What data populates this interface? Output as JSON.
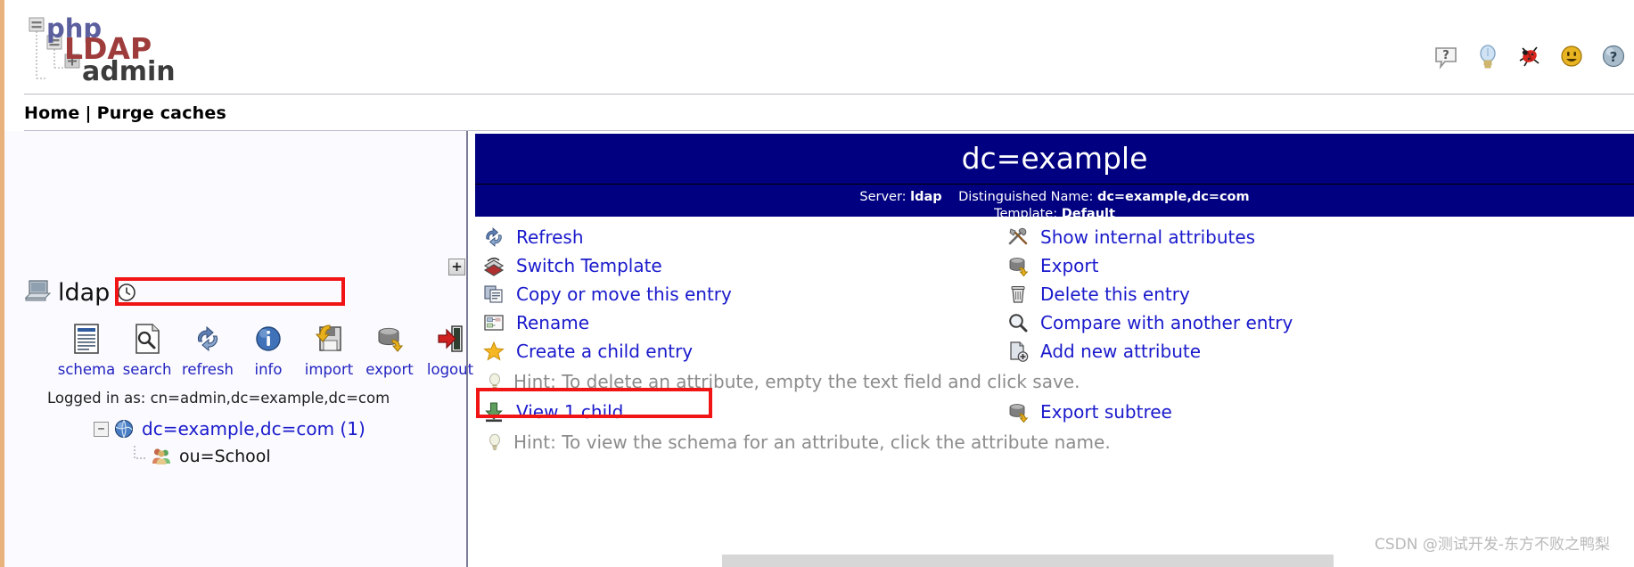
{
  "app": {
    "logo_parts": [
      "php",
      "LDAP",
      "admin"
    ],
    "title": "phpLDAPadmin"
  },
  "header": {
    "icons": [
      {
        "name": "help-tooltip-icon",
        "glyph": "?"
      },
      {
        "name": "lightbulb-icon",
        "glyph": "lightbulb"
      },
      {
        "name": "bug-icon",
        "glyph": "bug"
      },
      {
        "name": "smiley-icon",
        "glyph": "smiley"
      },
      {
        "name": "help-sphere-icon",
        "glyph": "?"
      }
    ]
  },
  "breadcrumb": {
    "home": "Home",
    "separator": "|",
    "purge": "Purge caches"
  },
  "sidebar": {
    "expand_label": "+",
    "server_name": "ldap",
    "tools": [
      {
        "label": "schema",
        "icon": "schema-icon"
      },
      {
        "label": "search",
        "icon": "search-icon"
      },
      {
        "label": "refresh",
        "icon": "refresh-icon"
      },
      {
        "label": "info",
        "icon": "info-icon"
      },
      {
        "label": "import",
        "icon": "import-icon"
      },
      {
        "label": "export",
        "icon": "export-icon"
      },
      {
        "label": "logout",
        "icon": "logout-icon"
      }
    ],
    "logged_in_as": "Logged in as: cn=admin,dc=example,dc=com",
    "tree": {
      "root": {
        "toggle": "−",
        "label": "dc=example,dc=com (1)",
        "icon": "globe-icon",
        "highlighted": true
      },
      "children": [
        {
          "label": "ou=School",
          "icon": "users-icon"
        }
      ]
    }
  },
  "main": {
    "entry_title": "dc=example",
    "meta": {
      "server_label": "Server:",
      "server_value": "ldap",
      "dn_label": "Distinguished Name:",
      "dn_value": "dc=example,dc=com",
      "template_label": "Template:",
      "template_value": "Default"
    },
    "rows": [
      {
        "left": {
          "label": "Refresh",
          "icon": "refresh-icon",
          "kind": "link"
        },
        "right": {
          "label": "Show internal attributes",
          "icon": "tools-icon",
          "kind": "link"
        }
      },
      {
        "left": {
          "label": "Switch Template",
          "icon": "switch-template-icon",
          "kind": "link"
        },
        "right": {
          "label": "Export",
          "icon": "export-icon",
          "kind": "link"
        }
      },
      {
        "left": {
          "label": "Copy or move this entry",
          "icon": "copy-icon",
          "kind": "link"
        },
        "right": {
          "label": "Delete this entry",
          "icon": "trash-icon",
          "kind": "link"
        }
      },
      {
        "left": {
          "label": "Rename",
          "icon": "rename-icon",
          "kind": "link"
        },
        "right": {
          "label": "Compare with another entry",
          "icon": "compare-icon",
          "kind": "link"
        }
      },
      {
        "left": {
          "label": "Create a child entry",
          "icon": "star-icon",
          "kind": "link",
          "highlighted": true
        },
        "right": {
          "label": "Add new attribute",
          "icon": "add-attribute-icon",
          "kind": "link"
        }
      }
    ],
    "hint_delete": "Hint: To delete an attribute, empty the text field and click save.",
    "view_children": {
      "label": "View 1 child",
      "icon": "download-icon"
    },
    "export_subtree": {
      "label": "Export subtree",
      "icon": "export-icon"
    },
    "hint_schema": "Hint: To view the schema for an attribute, click the attribute name."
  },
  "watermark": "CSDN @测试开发-东方不败之鸭梨",
  "colors": {
    "banner_blue": "#000080",
    "link_blue": "#1a1acc",
    "highlight_red": "#f01414",
    "hint_gray": "#8c8c8c",
    "left_stripe": "#e8b27d"
  }
}
